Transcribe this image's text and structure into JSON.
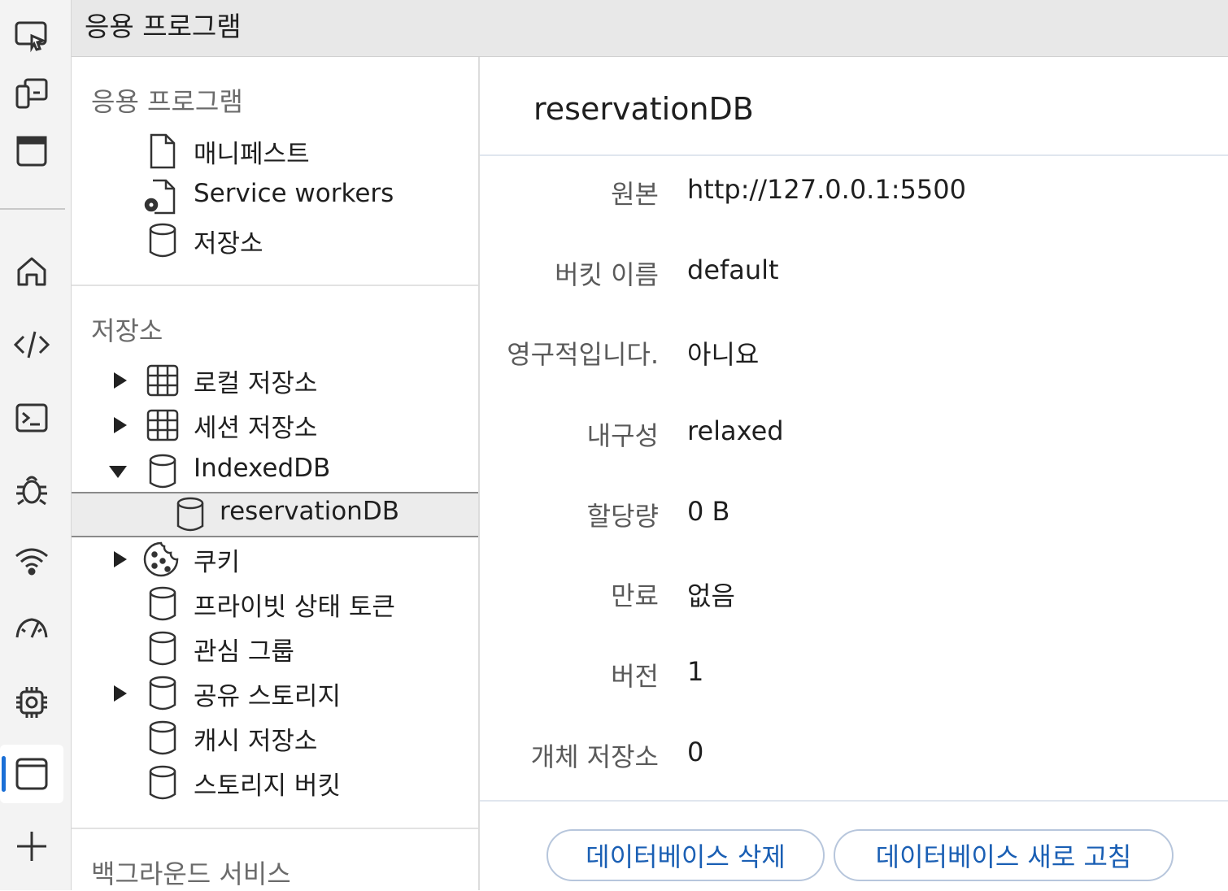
{
  "titlebar": {
    "title": "응용 프로그램"
  },
  "activity_bar": {
    "items": [
      {
        "icon": "inspect-icon"
      },
      {
        "icon": "device-emulation-icon"
      },
      {
        "icon": "window-icon"
      },
      {
        "icon": "home-icon"
      },
      {
        "icon": "code-icon"
      },
      {
        "icon": "console-icon"
      },
      {
        "icon": "bug-icon"
      },
      {
        "icon": "wifi-icon"
      },
      {
        "icon": "performance-icon"
      },
      {
        "icon": "cpu-icon"
      },
      {
        "icon": "application-icon",
        "active": true
      },
      {
        "icon": "plus-icon"
      }
    ],
    "accent": "#1a6fd6"
  },
  "sidebar": {
    "app_section": {
      "heading": "응용 프로그램",
      "items": [
        {
          "label": "매니페스트",
          "icon": "file-icon"
        },
        {
          "label": "Service workers",
          "icon": "service-worker-icon"
        },
        {
          "label": "저장소",
          "icon": "database-icon"
        }
      ]
    },
    "storage_section": {
      "heading": "저장소",
      "items": [
        {
          "label": "로컬 저장소",
          "icon": "grid-icon",
          "expandable": true
        },
        {
          "label": "세션 저장소",
          "icon": "grid-icon",
          "expandable": true
        },
        {
          "label": "IndexedDB",
          "icon": "database-icon",
          "expanded": true
        },
        {
          "label": "reservationDB",
          "icon": "database-icon",
          "selected": true
        },
        {
          "label": "쿠키",
          "icon": "cookie-icon",
          "expandable": true
        },
        {
          "label": "프라이빗 상태 토큰",
          "icon": "database-icon"
        },
        {
          "label": "관심 그룹",
          "icon": "database-icon"
        },
        {
          "label": "공유 스토리지",
          "icon": "database-icon",
          "expandable": true
        },
        {
          "label": "캐시 저장소",
          "icon": "database-icon"
        },
        {
          "label": "스토리지 버킷",
          "icon": "database-icon"
        }
      ]
    },
    "background_section": {
      "heading": "백그라운드 서비스"
    }
  },
  "main": {
    "title": "reservationDB",
    "properties": [
      {
        "key": "원본",
        "value": "http://127.0.0.1:5500"
      },
      {
        "key": "버킷 이름",
        "value": "default"
      },
      {
        "key": "영구적입니다.",
        "value": "아니요"
      },
      {
        "key": "내구성",
        "value": "relaxed"
      },
      {
        "key": "할당량",
        "value": "0 B"
      },
      {
        "key": "만료",
        "value": "없음"
      },
      {
        "key": "버전",
        "value": "1"
      },
      {
        "key": "개체 저장소",
        "value": "0"
      }
    ],
    "buttons": {
      "delete_label": "데이터베이스 삭제",
      "refresh_label": "데이터베이스 새로 고침"
    }
  }
}
